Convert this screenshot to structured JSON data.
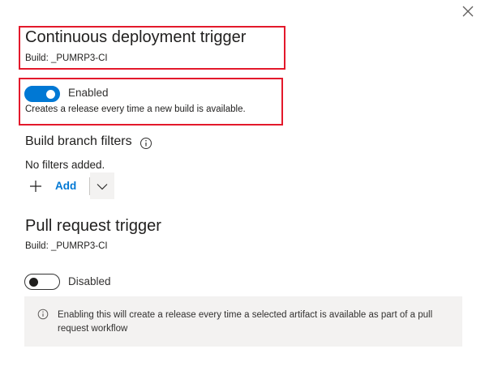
{
  "panel": {
    "close_label": "Close"
  },
  "cd_trigger": {
    "title": "Continuous deployment trigger",
    "build": "Build: _PUMRP3-CI",
    "toggle_state": "on",
    "toggle_label": "Enabled",
    "description": "Creates a release every time a new build is available."
  },
  "branch_filters": {
    "title": "Build branch filters",
    "info_icon": "info-icon",
    "empty_text": "No filters added.",
    "add_label": "Add",
    "add_icon": "plus-icon",
    "dropdown_icon": "chevron-down-icon"
  },
  "pr_trigger": {
    "title": "Pull request trigger",
    "build": "Build: _PUMRP3-CI",
    "toggle_state": "off",
    "toggle_label": "Disabled",
    "info_icon": "info-icon",
    "info_text": "Enabling this will create a release every time a selected artifact is available as part of a pull request workflow"
  },
  "colors": {
    "accent": "#0078d4",
    "highlight_border": "#e3192b",
    "banner_bg": "#f3f2f1"
  }
}
